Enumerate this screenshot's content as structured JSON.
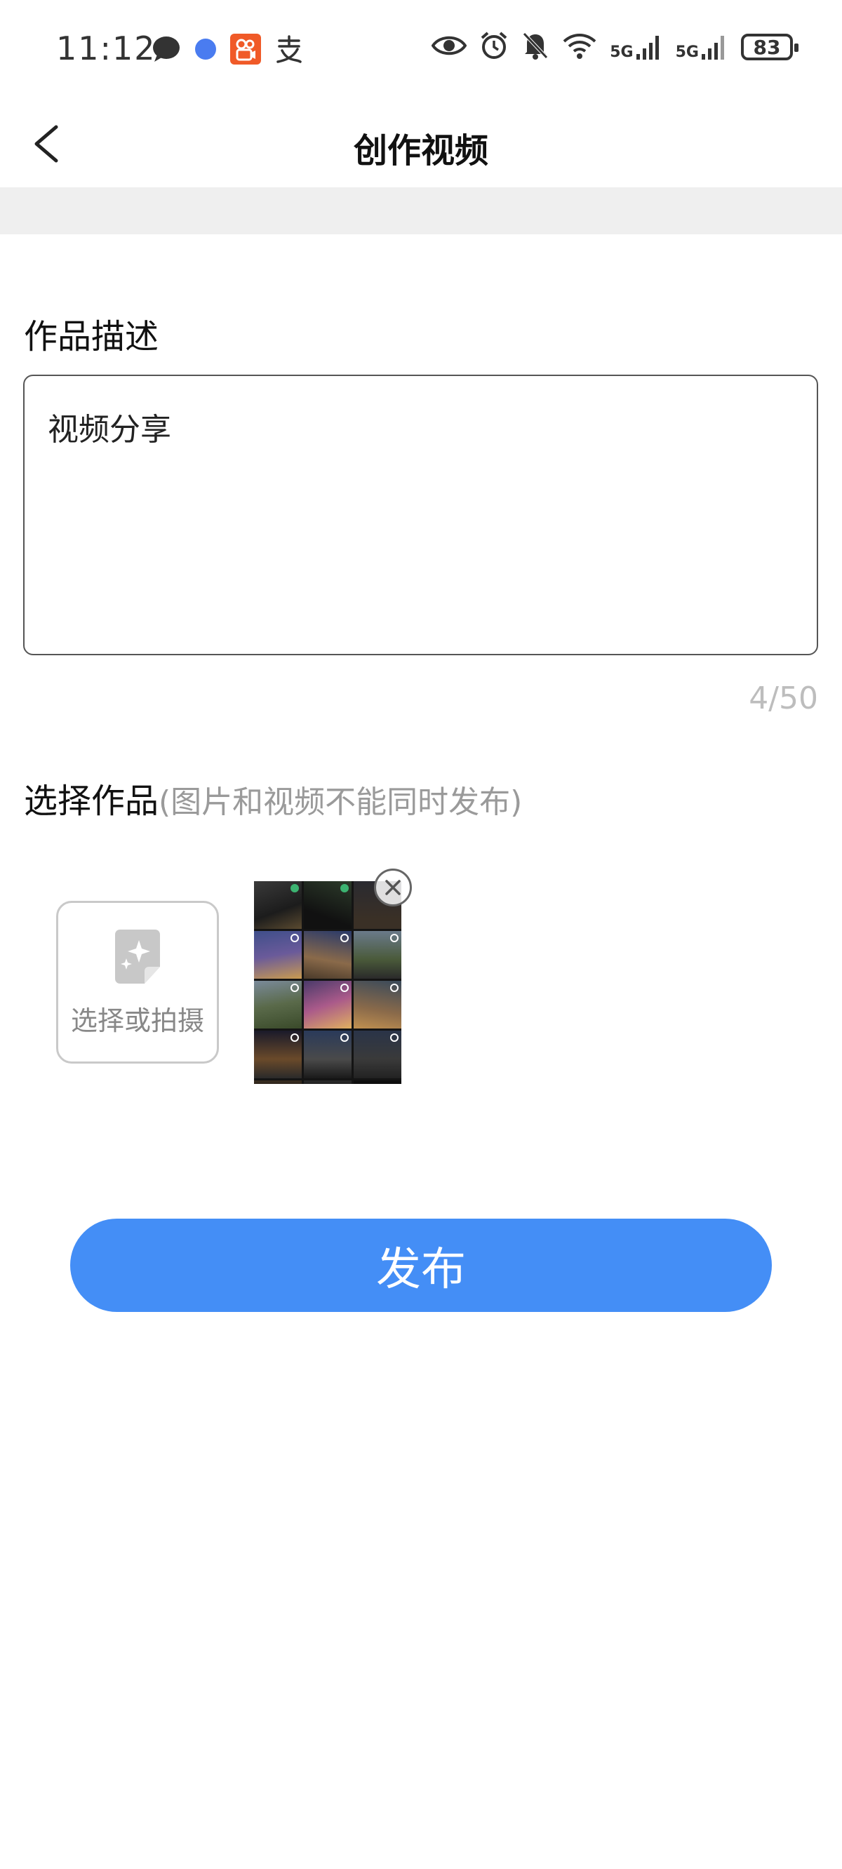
{
  "status_bar": {
    "time": "11:12",
    "battery": "83",
    "signal_1": "5G",
    "signal_2": "5G",
    "left_icons": [
      "chat-bubble-icon",
      "blue-dot-icon",
      "kuaishou-app-icon",
      "alipay-icon"
    ],
    "right_icons": [
      "eye-icon",
      "alarm-icon",
      "mute-bell-icon",
      "wifi-icon",
      "cell-signal-icon",
      "cell-signal-icon",
      "battery-icon"
    ],
    "app_icon_color": "#f05a28",
    "dot_color": "#4a7cf0"
  },
  "header": {
    "title": "创作视频",
    "back_icon": "chevron-left-icon"
  },
  "description": {
    "label": "作品描述",
    "value": "视频分享",
    "counter": "4/50"
  },
  "works": {
    "label": "选择作品",
    "hint": "(图片和视频不能同时发布)",
    "pick_label": "选择或拍摄",
    "pick_icon": "sparkle-image-icon",
    "remove_icon": "close-circle-icon"
  },
  "publish": {
    "label": "发布",
    "color": "#448ef6"
  }
}
